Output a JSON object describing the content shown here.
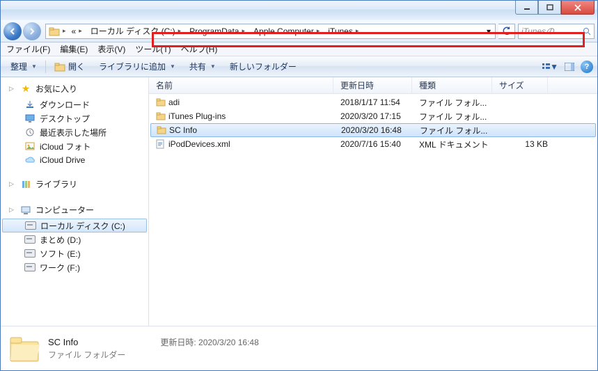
{
  "breadcrumbs": [
    "ローカル ディスク (C:)",
    "ProgramData",
    "Apple Computer",
    "iTunes"
  ],
  "search_placeholder": "iTunesの...",
  "menu": {
    "file": "ファイル(F)",
    "edit": "編集(E)",
    "view": "表示(V)",
    "tools": "ツール(T)",
    "help": "ヘルプ(H)"
  },
  "toolbar": {
    "organize": "整理",
    "open": "開く",
    "library": "ライブラリに追加",
    "share": "共有",
    "newfolder": "新しいフォルダー"
  },
  "tree": {
    "favorites": "お気に入り",
    "fav_items": [
      "ダウンロード",
      "デスクトップ",
      "最近表示した場所",
      "iCloud フォト",
      "iCloud Drive"
    ],
    "libraries": "ライブラリ",
    "computer": "コンピューター",
    "drives": [
      "ローカル ディスク (C:)",
      "まとめ (D:)",
      "ソフト (E:)",
      "ワーク (F:)"
    ]
  },
  "cols": {
    "name": "名前",
    "date": "更新日時",
    "type": "種類",
    "size": "サイズ"
  },
  "rows": [
    {
      "name": "adi",
      "date": "2018/1/17 11:54",
      "type": "ファイル フォル...",
      "size": "",
      "kind": "folder",
      "sel": false
    },
    {
      "name": "iTunes Plug-ins",
      "date": "2020/3/20 17:15",
      "type": "ファイル フォル...",
      "size": "",
      "kind": "folder",
      "sel": false
    },
    {
      "name": "SC Info",
      "date": "2020/3/20 16:48",
      "type": "ファイル フォル...",
      "size": "",
      "kind": "folder",
      "sel": true
    },
    {
      "name": "iPodDevices.xml",
      "date": "2020/7/16 15:40",
      "type": "XML ドキュメント",
      "size": "13 KB",
      "kind": "xml",
      "sel": false
    }
  ],
  "details": {
    "name": "SC Info",
    "type": "ファイル フォルダー",
    "meta_label": "更新日時:",
    "meta_value": "2020/3/20 16:48"
  }
}
